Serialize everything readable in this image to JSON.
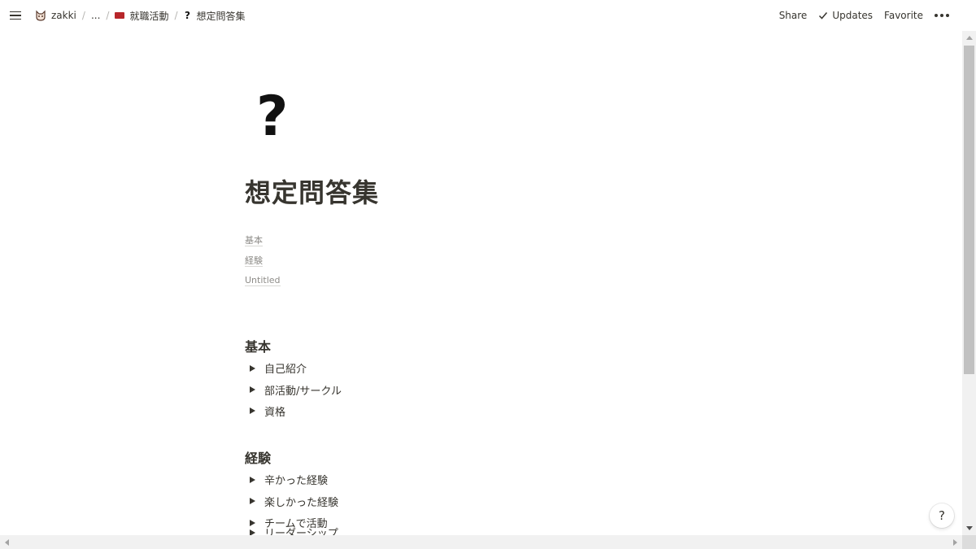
{
  "topbar": {
    "breadcrumbs": [
      {
        "label": "zakki",
        "icon": "cat-icon"
      },
      {
        "label": "..."
      },
      {
        "label": "就職活動",
        "icon": "book-icon",
        "icon_color": "#b7262a"
      },
      {
        "label": "想定問答集",
        "icon": "question-mark-icon"
      }
    ],
    "separator": "/",
    "share_label": "Share",
    "updates_label": "Updates",
    "favorite_label": "Favorite",
    "more_icon": "more-horizontal-icon"
  },
  "page": {
    "icon_glyph": "?",
    "title": "想定問答集",
    "toc": [
      "基本",
      "経験",
      "Untitled"
    ],
    "sections": [
      {
        "heading": "基本",
        "toggles": [
          "自己紹介",
          "部活動/サークル",
          "資格"
        ]
      },
      {
        "heading": "経験",
        "toggles": [
          "辛かった経験",
          "楽しかった経験",
          "チームで活動"
        ]
      }
    ],
    "partially_visible_toggle": "リーダーシップ"
  },
  "help_button": "?"
}
